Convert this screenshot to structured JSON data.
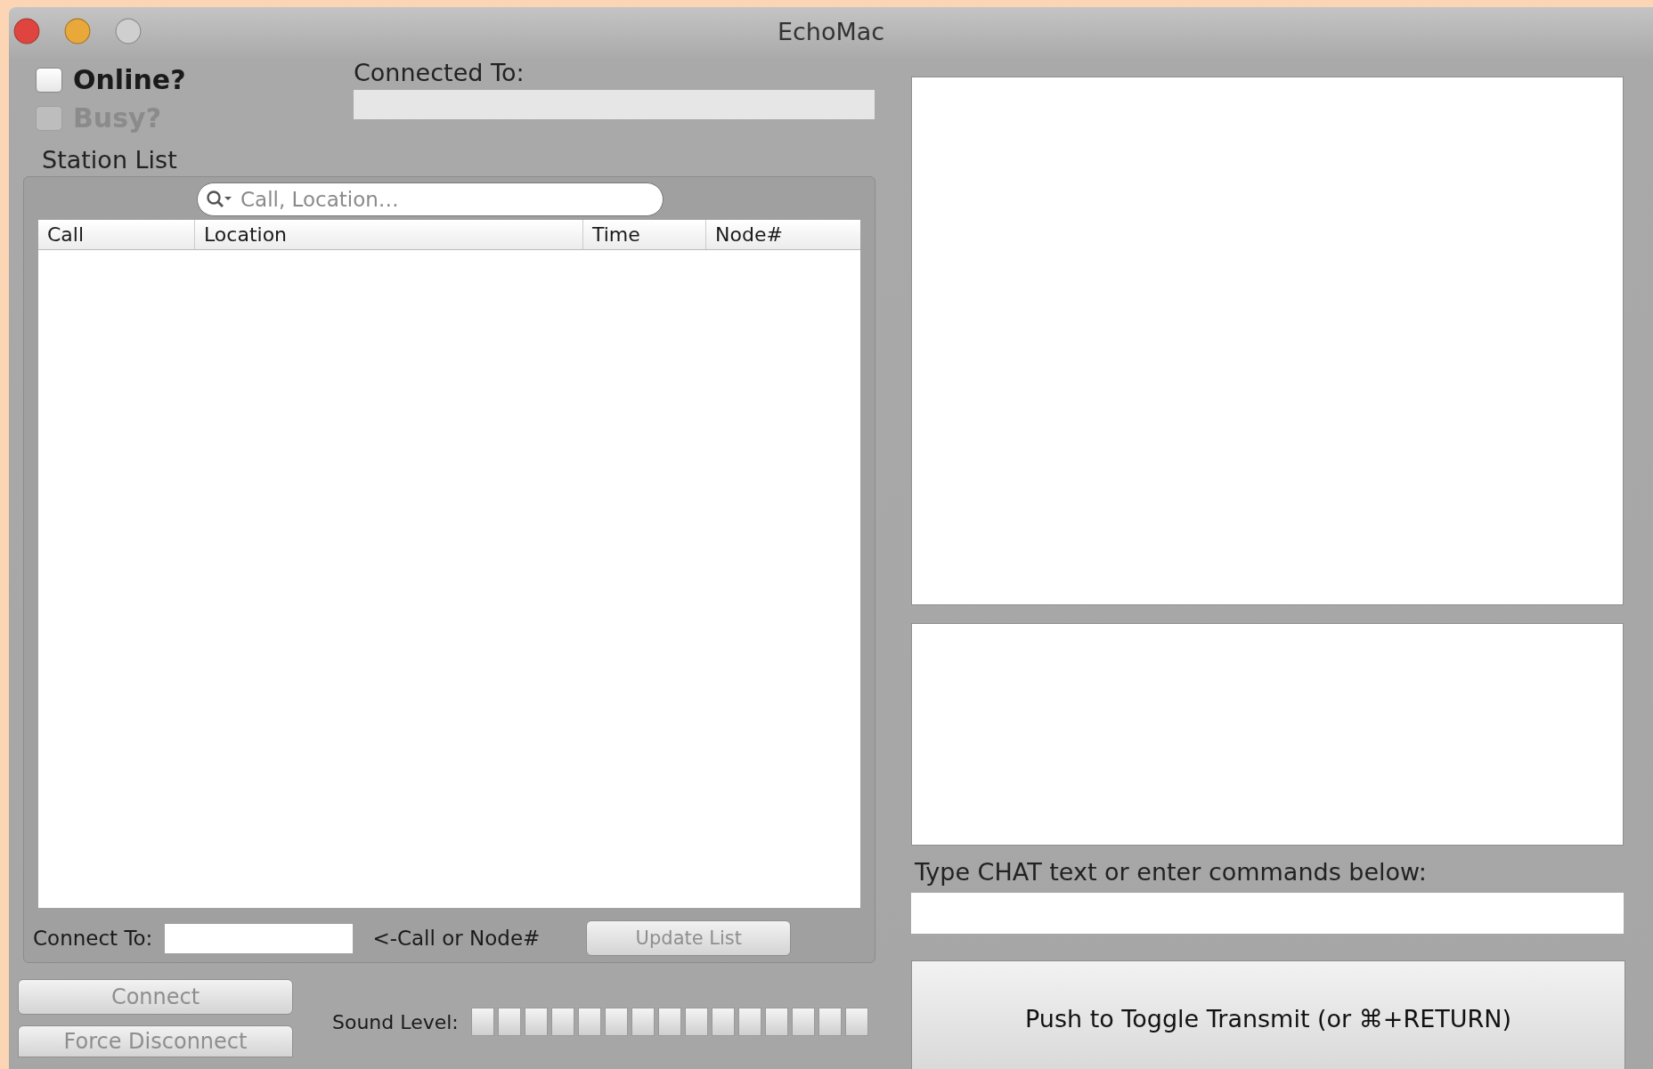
{
  "window": {
    "title": "EchoMac"
  },
  "status": {
    "online": {
      "label": "Online?",
      "checked": false
    },
    "busy": {
      "label": "Busy?",
      "checked": false,
      "disabled": true
    },
    "connected_to": {
      "label": "Connected To:"
    }
  },
  "station_list": {
    "title": "Station List",
    "search": {
      "placeholder": "Call, Location…"
    },
    "columns": [
      "Call",
      "Location",
      "Time",
      "Node#"
    ]
  },
  "connect_to": {
    "label": "Connect To:",
    "hint": "<-Call or Node#"
  },
  "buttons": {
    "update_list": {
      "label": "Update List",
      "disabled": true
    },
    "connect": {
      "label": "Connect",
      "disabled": true
    },
    "force_disconnect": {
      "label": "Force Disconnect",
      "disabled": true
    }
  },
  "sound_level": {
    "label": "Sound Level:"
  },
  "chat": {
    "prompt": "Type CHAT text or enter commands below:",
    "transmit": {
      "label": "Push to Toggle Transmit (or ⌘+RETURN)",
      "disabled": false
    }
  }
}
